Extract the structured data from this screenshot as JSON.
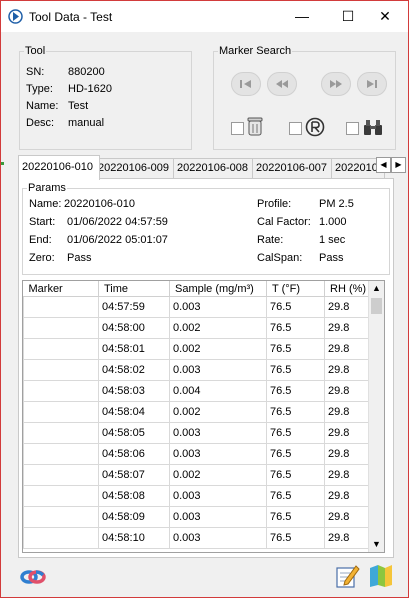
{
  "window": {
    "title": "Tool Data - Test",
    "minimize": "—",
    "maximize": "☐",
    "close": "✕"
  },
  "tool": {
    "group_label": "Tool",
    "fields": [
      {
        "label": "SN:",
        "value": "880200"
      },
      {
        "label": "Type:",
        "value": "HD-1620"
      },
      {
        "label": "Name:",
        "value": "Test"
      },
      {
        "label": "Desc:",
        "value": "manual"
      }
    ]
  },
  "marker_search": {
    "group_label": "Marker Search"
  },
  "tabs": [
    "20220106-010",
    "20220106-009",
    "20220106-008",
    "20220106-007",
    "2022010"
  ],
  "params": {
    "group_label": "Params",
    "left": [
      {
        "label": "Name:",
        "value": "20220106-010"
      },
      {
        "label": "Start:",
        "value": "01/06/2022 04:57:59"
      },
      {
        "label": "End:",
        "value": "01/06/2022 05:01:07"
      },
      {
        "label": "Zero:",
        "value": "Pass"
      }
    ],
    "right": [
      {
        "label": "Profile:",
        "value": "PM 2.5"
      },
      {
        "label": "Cal Factor:",
        "value": "1.000"
      },
      {
        "label": "Rate:",
        "value": "1 sec"
      },
      {
        "label": "CalSpan:",
        "value": "Pass"
      }
    ]
  },
  "table": {
    "columns": [
      "Marker",
      "Time",
      "Sample (mg/m³)",
      "T (°F)",
      "RH (%)"
    ],
    "rows": [
      [
        "",
        "04:57:59",
        "0.003",
        "76.5",
        "29.8"
      ],
      [
        "",
        "04:58:00",
        "0.002",
        "76.5",
        "29.8"
      ],
      [
        "",
        "04:58:01",
        "0.002",
        "76.5",
        "29.8"
      ],
      [
        "",
        "04:58:02",
        "0.003",
        "76.5",
        "29.8"
      ],
      [
        "",
        "04:58:03",
        "0.004",
        "76.5",
        "29.8"
      ],
      [
        "",
        "04:58:04",
        "0.002",
        "76.5",
        "29.8"
      ],
      [
        "",
        "04:58:05",
        "0.003",
        "76.5",
        "29.8"
      ],
      [
        "",
        "04:58:06",
        "0.003",
        "76.5",
        "29.8"
      ],
      [
        "",
        "04:58:07",
        "0.002",
        "76.5",
        "29.8"
      ],
      [
        "",
        "04:58:08",
        "0.003",
        "76.5",
        "29.8"
      ],
      [
        "",
        "04:58:09",
        "0.003",
        "76.5",
        "29.8"
      ],
      [
        "",
        "04:58:10",
        "0.003",
        "76.5",
        "29.8"
      ]
    ]
  },
  "icons": [
    "app-logo-icon",
    "first-marker-icon",
    "previous-marker-icon",
    "next-marker-icon",
    "last-marker-icon",
    "trash-icon",
    "record-icon",
    "binoculars-icon",
    "sync-icon",
    "edit-icon",
    "export-icon"
  ]
}
